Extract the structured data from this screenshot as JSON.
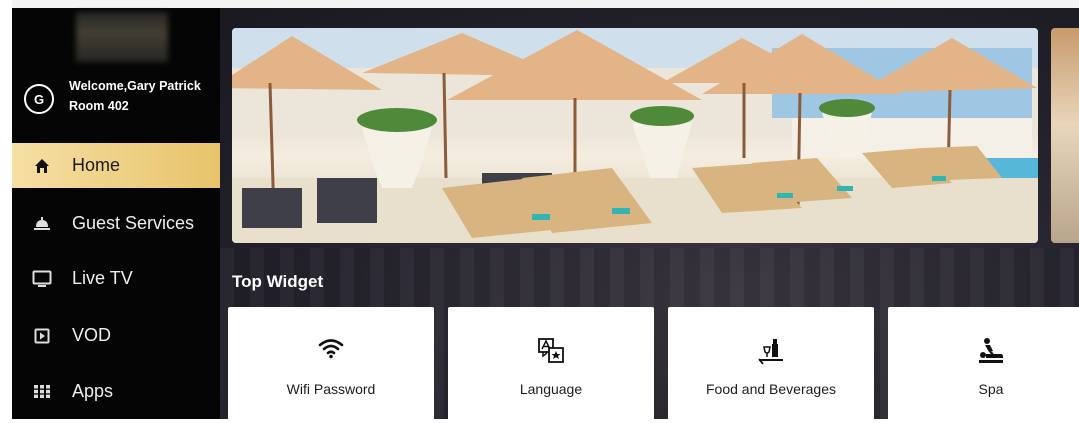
{
  "user": {
    "initial": "G",
    "welcome": "Welcome,Gary Patrick",
    "room": "Room 402"
  },
  "nav": {
    "items": [
      {
        "label": "Home",
        "icon": "home-icon",
        "active": true
      },
      {
        "label": "Guest Services",
        "icon": "bell-icon",
        "active": false
      },
      {
        "label": "Live TV",
        "icon": "tv-icon",
        "active": false
      },
      {
        "label": "VOD",
        "icon": "play-icon",
        "active": false
      },
      {
        "label": "Apps",
        "icon": "grid-icon",
        "active": false
      }
    ]
  },
  "main": {
    "section_title": "Top Widget",
    "widgets": [
      {
        "label": "Wifi Password",
        "icon": "wifi-icon"
      },
      {
        "label": "Language",
        "icon": "translate-icon"
      },
      {
        "label": "Food and Beverages",
        "icon": "dining-icon"
      },
      {
        "label": "Spa",
        "icon": "spa-icon"
      }
    ]
  },
  "colors": {
    "sidebar_bg": "#050505",
    "accent_gold": "#e7c46b",
    "main_bg": "#24222c",
    "tile_bg": "#ffffff"
  }
}
